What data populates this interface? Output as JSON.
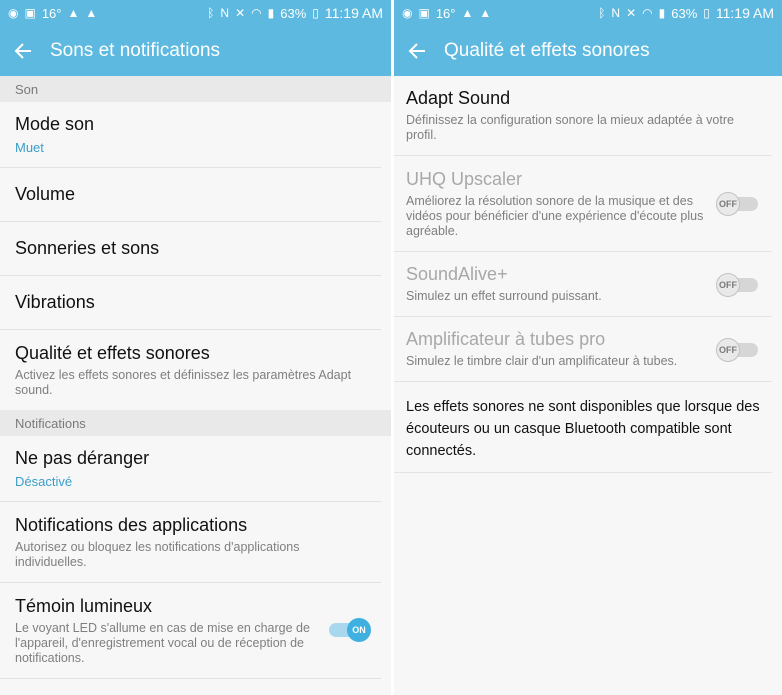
{
  "status_left": {
    "temp": "16°",
    "icons": [
      "notification-icon",
      "image-icon",
      "alert-icon",
      "alert-icon"
    ]
  },
  "status_right": {
    "battery": "63%",
    "time": "11:19 AM"
  },
  "left": {
    "title": "Sons et notifications",
    "section_son": "Son",
    "mode_son": {
      "title": "Mode son",
      "value": "Muet"
    },
    "volume": {
      "title": "Volume"
    },
    "sonneries": {
      "title": "Sonneries et sons"
    },
    "vibrations": {
      "title": "Vibrations"
    },
    "qualite": {
      "title": "Qualité et effets sonores",
      "sub": "Activez les effets sonores et définissez les paramètres Adapt sound."
    },
    "section_notifications": "Notifications",
    "ne_pas_deranger": {
      "title": "Ne pas déranger",
      "value": "Désactivé"
    },
    "notif_apps": {
      "title": "Notifications des applications",
      "sub": "Autorisez ou bloquez les notifications d'applications individuelles."
    },
    "temoin": {
      "title": "Témoin lumineux",
      "sub": "Le voyant LED s'allume en cas de mise en charge de l'appareil, d'enregistrement vocal ou de réception de notifications.",
      "toggle": "ON",
      "enabled": true
    }
  },
  "right": {
    "title": "Qualité et effets sonores",
    "adapt": {
      "title": "Adapt Sound",
      "sub": "Définissez la configuration sonore la mieux adaptée à votre profil."
    },
    "uhq": {
      "title": "UHQ Upscaler",
      "sub": "Améliorez la résolution sonore de la musique et des vidéos pour bénéficier d'une expérience d'écoute plus agréable.",
      "toggle": "OFF"
    },
    "soundalive": {
      "title": "SoundAlive+",
      "sub": "Simulez un effet surround puissant.",
      "toggle": "OFF"
    },
    "ampli": {
      "title": "Amplificateur à tubes pro",
      "sub": "Simulez le timbre clair d'un amplificateur à tubes.",
      "toggle": "OFF"
    },
    "note": "Les effets sonores ne sont disponibles que lorsque des écouteurs ou un casque Bluetooth compatible sont connectés."
  },
  "colors": {
    "appbar": "#5db9e0",
    "accent": "#3a9ec9",
    "toggle_on": "#3fb0df"
  }
}
